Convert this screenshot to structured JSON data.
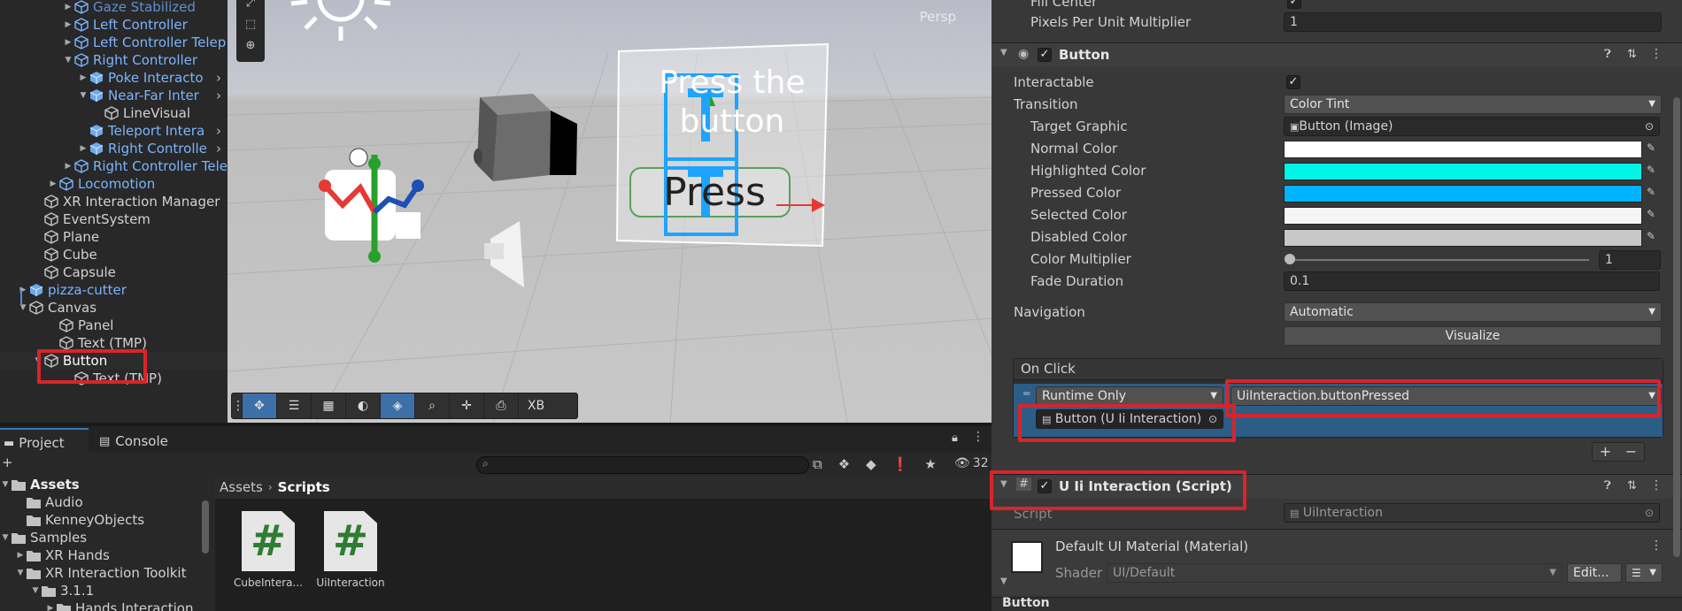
{
  "hierarchy": {
    "items": [
      {
        "label": "Gaze Stabilized",
        "depth": 5,
        "arrow": "▶",
        "blue": true,
        "dim": true
      },
      {
        "label": "Left Controller",
        "depth": 5,
        "arrow": "▶",
        "blue": true
      },
      {
        "label": "Left Controller Telep",
        "depth": 5,
        "arrow": "▶",
        "blue": true
      },
      {
        "label": "Right Controller",
        "depth": 5,
        "arrow": "▼",
        "blue": true
      },
      {
        "label": "Poke Interacto",
        "depth": 6,
        "arrow": "▶",
        "blue": true,
        "prefab": true
      },
      {
        "label": "Near-Far Inter",
        "depth": 6,
        "arrow": "▼",
        "blue": true,
        "prefab": true
      },
      {
        "label": "LineVisual",
        "depth": 7,
        "arrow": "",
        "blue": false
      },
      {
        "label": "Teleport Intera",
        "depth": 6,
        "arrow": "",
        "blue": true,
        "prefab": true
      },
      {
        "label": "Right Controlle",
        "depth": 6,
        "arrow": "▶",
        "blue": true,
        "prefab": true
      },
      {
        "label": "Right Controller Tele",
        "depth": 5,
        "arrow": "▶",
        "blue": true
      },
      {
        "label": "Locomotion",
        "depth": 4,
        "arrow": "▶",
        "blue": true
      },
      {
        "label": "XR Interaction Manager",
        "depth": 3,
        "arrow": "",
        "blue": false
      },
      {
        "label": "EventSystem",
        "depth": 3,
        "arrow": "",
        "blue": false
      },
      {
        "label": "Plane",
        "depth": 3,
        "arrow": "",
        "blue": false
      },
      {
        "label": "Cube",
        "depth": 3,
        "arrow": "",
        "blue": false
      },
      {
        "label": "Capsule",
        "depth": 3,
        "arrow": "",
        "blue": false
      },
      {
        "label": "pizza-cutter",
        "depth": 2,
        "arrow": "▶",
        "blue": true,
        "prefab": true
      },
      {
        "label": "Canvas",
        "depth": 2,
        "arrow": "▼",
        "blue": false
      },
      {
        "label": "Panel",
        "depth": 4,
        "arrow": "",
        "blue": false
      },
      {
        "label": "Text (TMP)",
        "depth": 4,
        "arrow": "",
        "blue": false
      },
      {
        "label": "Button",
        "depth": 3,
        "arrow": "▼",
        "blue": false,
        "selected": true
      },
      {
        "label": "Text (TMP)",
        "depth": 5,
        "arrow": "",
        "blue": false
      }
    ]
  },
  "scene": {
    "persp_label": "Persp",
    "ui_text_top": "Press the button",
    "ui_button_text": "Press",
    "toolbar_last": "XB"
  },
  "project": {
    "tabs": [
      "Project",
      "Console"
    ],
    "hidden_count": "32",
    "add_label": "+",
    "tree": [
      {
        "label": "Assets",
        "depth": 0,
        "arrow": "▼",
        "bold": true
      },
      {
        "label": "Audio",
        "depth": 1,
        "arrow": ""
      },
      {
        "label": "KenneyObjects",
        "depth": 1,
        "arrow": ""
      },
      {
        "label": "Samples",
        "depth": 0,
        "arrow": "▼"
      },
      {
        "label": "XR Hands",
        "depth": 1,
        "arrow": "▶"
      },
      {
        "label": "XR Interaction Toolkit",
        "depth": 1,
        "arrow": "▼"
      },
      {
        "label": "3.1.1",
        "depth": 2,
        "arrow": "▼"
      },
      {
        "label": "Hands Interaction",
        "depth": 3,
        "arrow": "▶"
      }
    ],
    "breadcrumb": [
      "Assets",
      "Scripts"
    ],
    "files": [
      {
        "label": "CubeIntera..."
      },
      {
        "label": "UiInteraction"
      }
    ]
  },
  "inspector": {
    "fill_center": "Fill Center",
    "ppu_label": "Pixels Per Unit Multiplier",
    "ppu_value": "1",
    "button_title": "Button",
    "interactable": "Interactable",
    "transition": "Transition",
    "transition_value": "Color Tint",
    "target_graphic": "Target Graphic",
    "target_graphic_value": "Button (Image)",
    "normal_color": "Normal Color",
    "highlighted_color": "Highlighted Color",
    "pressed_color": "Pressed Color",
    "selected_color": "Selected Color",
    "disabled_color": "Disabled Color",
    "color_multiplier": "Color Multiplier",
    "color_multiplier_value": "1",
    "fade_duration": "Fade Duration",
    "fade_duration_value": "0.1",
    "navigation": "Navigation",
    "navigation_value": "Automatic",
    "visualize": "Visualize",
    "on_click": "On Click",
    "runtime_only": "Runtime Only",
    "function": "UiInteraction.buttonPressed",
    "target_object": "Button (U Ii Interaction)",
    "plus": "+",
    "minus": "−",
    "script_title": "U Ii Interaction (Script)",
    "script_label": "Script",
    "script_value": "UiInteraction",
    "material_title": "Default UI Material (Material)",
    "shader_label": "Shader",
    "shader_value": "UI/Default",
    "edit": "Edit...",
    "footer": "Button"
  },
  "colors": {
    "normal": "#ffffff",
    "highlighted": "#00f5e9",
    "pressed": "#00b3ff",
    "selected": "#f5f5f5",
    "disabled": "#c8c8c8",
    "accent_blue": "#7bb5ff",
    "highlight_red": "#d9242a"
  }
}
